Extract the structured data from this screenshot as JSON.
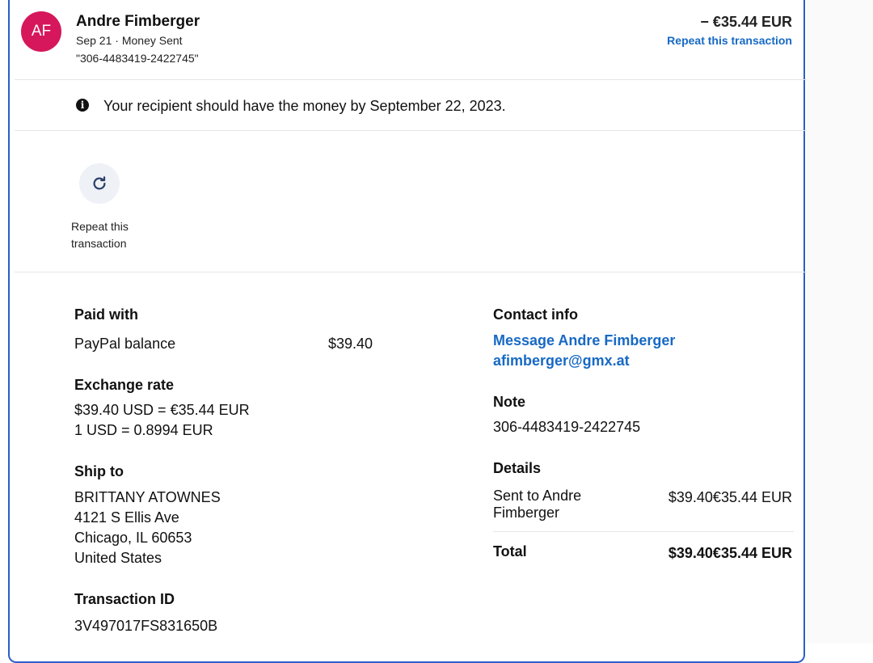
{
  "header": {
    "avatar_initials": "AF",
    "avatar_color": "#d6175c",
    "name": "Andre Fimberger",
    "date": "Sep 21",
    "type": "Money Sent",
    "reference": "\"306-4483419-2422745\"",
    "amount": "− €35.44 EUR",
    "repeat_link": "Repeat this transaction"
  },
  "notice": {
    "icon": "info-icon",
    "text": "Your recipient should have the money by September 22, 2023."
  },
  "actions": {
    "repeat_icon": "refresh-icon",
    "repeat_line1": "Repeat this",
    "repeat_line2": "transaction"
  },
  "paid_with": {
    "heading": "Paid with",
    "method": "PayPal balance",
    "amount": "$39.40"
  },
  "exchange": {
    "heading": "Exchange rate",
    "line1": "$39.40 USD = €35.44 EUR",
    "line2": "1 USD = 0.8994 EUR"
  },
  "ship_to": {
    "heading": "Ship to",
    "name": "BRITTANY ATOWNES",
    "street": "4121 S Ellis Ave",
    "city": "Chicago, IL 60653",
    "country": "United States"
  },
  "transaction": {
    "heading": "Transaction ID",
    "id": "3V497017FS831650B"
  },
  "contact": {
    "heading": "Contact info",
    "message_link": "Message Andre Fimberger",
    "email": "afimberger@gmx.at"
  },
  "note": {
    "heading": "Note",
    "text": "306-4483419-2422745"
  },
  "details": {
    "heading": "Details",
    "sent_to_line1": "Sent to Andre",
    "sent_to_line2": "Fimberger",
    "sent_amount": "$39.40€35.44 EUR",
    "total_label": "Total",
    "total_amount": "$39.40€35.44 EUR"
  },
  "colors": {
    "accent": "#1769c4",
    "border": "#2b5fc7"
  }
}
